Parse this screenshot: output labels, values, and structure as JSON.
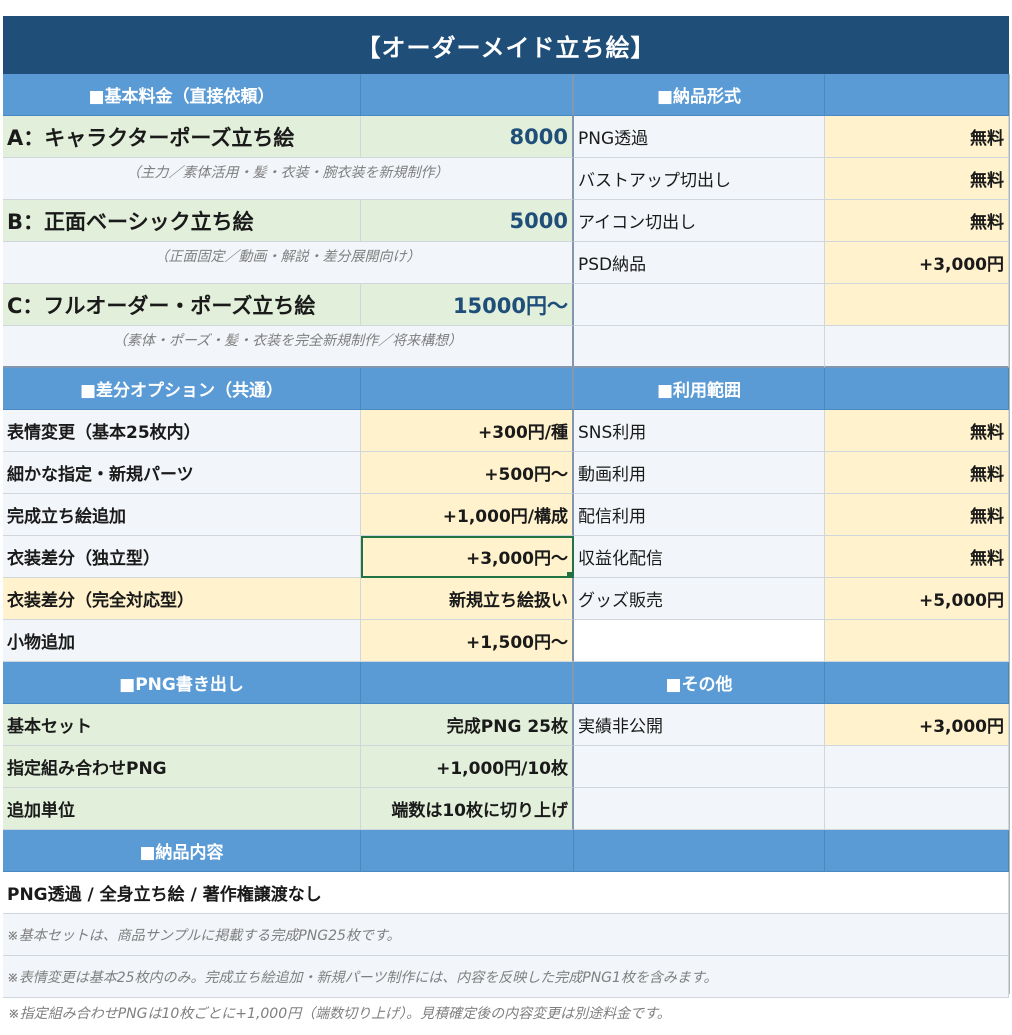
{
  "title": "【オーダーメイド立ち絵】",
  "basic": {
    "header": "■基本料金（直接依頼）",
    "items": [
      {
        "label": "A：キャラクターポーズ立ち絵",
        "price": "8000",
        "note": "（主力／素体活用・髪・衣装・腕衣装を新規制作）"
      },
      {
        "label": "B：正面ベーシック立ち絵",
        "price": "5000",
        "note": "（正面固定／動画・解説・差分展開向け）"
      },
      {
        "label": "C：フルオーダー・ポーズ立ち絵",
        "price": "15000円〜",
        "note": "（素体・ポーズ・髪・衣装を完全新規制作／将来構想）"
      }
    ]
  },
  "delivery_format": {
    "header": "■納品形式",
    "items": [
      {
        "label": "PNG透過",
        "price": "無料"
      },
      {
        "label": "バストアップ切出し",
        "price": "無料"
      },
      {
        "label": "アイコン切出し",
        "price": "無料"
      },
      {
        "label": "PSD納品",
        "price": "+3,000円"
      }
    ]
  },
  "diff": {
    "header": "■差分オプション（共通）",
    "items": [
      {
        "label": "表情変更（基本25枚内）",
        "price": "+300円/種"
      },
      {
        "label": "細かな指定・新規パーツ",
        "price": "+500円〜"
      },
      {
        "label": "完成立ち絵追加",
        "price": "+1,000円/構成"
      },
      {
        "label": "衣装差分（独立型）",
        "price": "+3,000円〜"
      },
      {
        "label": "衣装差分（完全対応型）",
        "price": "新規立ち絵扱い"
      },
      {
        "label": "小物追加",
        "price": "+1,500円〜"
      }
    ]
  },
  "usage": {
    "header": "■利用範囲",
    "items": [
      {
        "label": "SNS利用",
        "price": "無料"
      },
      {
        "label": "動画利用",
        "price": "無料"
      },
      {
        "label": "配信利用",
        "price": "無料"
      },
      {
        "label": "収益化配信",
        "price": "無料"
      },
      {
        "label": "グッズ販売",
        "price": "+5,000円"
      }
    ]
  },
  "png": {
    "header": "■PNG書き出し",
    "items": [
      {
        "label": "基本セット",
        "value": "完成PNG 25枚"
      },
      {
        "label": "指定組み合わせPNG",
        "value": "+1,000円/10枚"
      },
      {
        "label": "追加単位",
        "value": "端数は10枚に切り上げ"
      }
    ]
  },
  "other": {
    "header": "■その他",
    "items": [
      {
        "label": "実績非公開",
        "price": "+3,000円"
      }
    ]
  },
  "contents": {
    "header": "■納品内容",
    "main": "PNG透過 / 全身立ち絵 / 著作権譲渡なし",
    "notes": [
      "※基本セットは、商品サンプルに掲載する完成PNG25枚です。",
      "※表情変更は基本25枚内のみ。完成立ち絵追加・新規パーツ制作には、内容を反映した完成PNG1枚を含みます。"
    ]
  },
  "footer_note": "※指定組み合わせPNGは10枚ごとに+1,000円（端数切り上げ）。見積確定後の内容変更は別途料金です。",
  "colors": {
    "title_bg": "#1f4e79",
    "header_bg": "#5b9bd5",
    "green": "#e2efda",
    "yellow": "#fff2cc",
    "price_text": "#1f4e79",
    "selection": "#217346"
  }
}
